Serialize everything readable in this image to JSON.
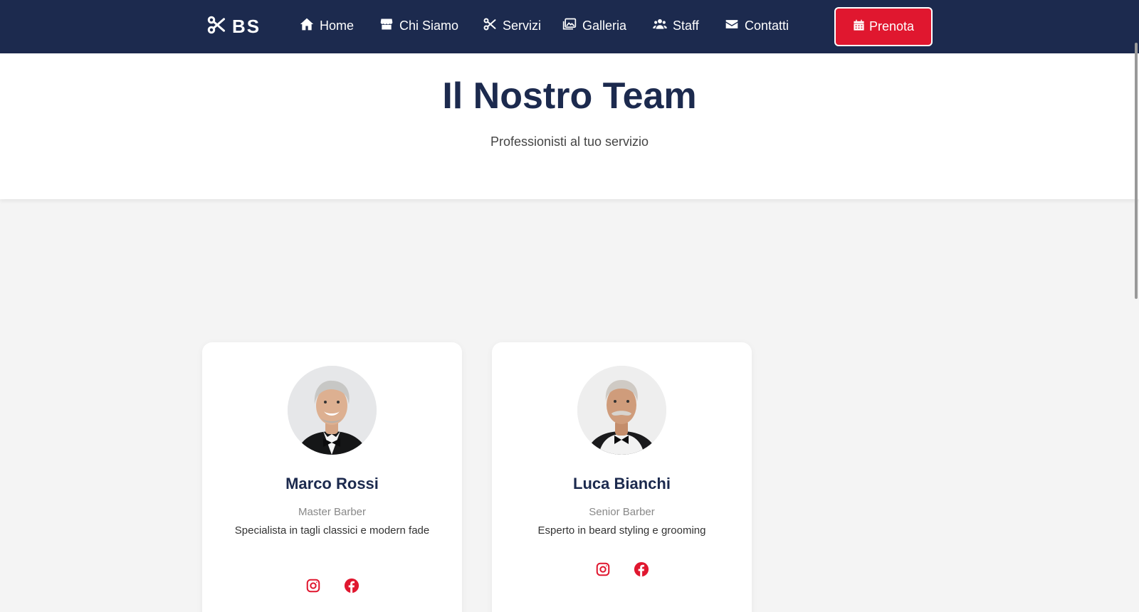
{
  "brand": {
    "logo_text": "BS"
  },
  "nav": {
    "items": [
      {
        "label": "Home",
        "icon": "home-icon"
      },
      {
        "label": "Chi Siamo",
        "icon": "store-icon"
      },
      {
        "label": "Servizi",
        "icon": "scissors-icon"
      },
      {
        "label": "Galleria",
        "icon": "images-icon"
      },
      {
        "label": "Staff",
        "icon": "users-icon"
      },
      {
        "label": "Contatti",
        "icon": "envelope-icon"
      }
    ],
    "cta_label": "Prenota",
    "cta_icon": "calendar-icon"
  },
  "hero": {
    "title": "Il Nostro Team",
    "subtitle": "Professionisti al tuo servizio"
  },
  "team": [
    {
      "name": "Marco Rossi",
      "role": "Master Barber",
      "description": "Specialista in tagli classici e modern fade",
      "socials": [
        "instagram-icon",
        "facebook-icon"
      ]
    },
    {
      "name": "Luca Bianchi",
      "role": "Senior Barber",
      "description": "Esperto in beard styling e grooming",
      "socials": [
        "instagram-icon",
        "facebook-icon"
      ]
    }
  ],
  "colors": {
    "navy": "#1c2a4e",
    "accent": "#e0172f",
    "background": "#f4f4f4"
  }
}
